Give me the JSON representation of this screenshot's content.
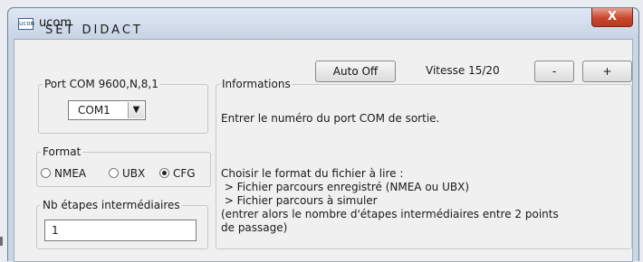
{
  "window": {
    "title": "ucom",
    "icon_label": "ucom-app-icon",
    "close_glyph": "X"
  },
  "heading": "SET DIDACT",
  "toolbar": {
    "auto_off_label": "Auto Off",
    "vitesse_label": "Vitesse 15/20",
    "minus_label": "-",
    "plus_label": "+"
  },
  "port_group": {
    "legend": "Port COM 9600,N,8,1",
    "selected": "COM1",
    "arrow": "▼"
  },
  "format_group": {
    "legend": "Format",
    "options": [
      {
        "label": "NMEA",
        "checked": false
      },
      {
        "label": "UBX",
        "checked": false
      },
      {
        "label": "CFG",
        "checked": true
      }
    ]
  },
  "steps_group": {
    "legend": "Nb étapes intermédiaires",
    "value": "1"
  },
  "info_group": {
    "legend": "Informations",
    "line1": "Entrer le numéro du port COM de sortie.",
    "block": [
      "Choisir le format du fichier à lire :",
      " > Fichier parcours enregistré (NMEA ou UBX)",
      " > Fichier parcours à simuler",
      "(entrer alors le nombre d'étapes intermédiaires entre 2 points",
      "de passage)"
    ]
  },
  "colors": {
    "close_button": "#c9462d",
    "client_bg": "#f0f0f0",
    "frame": "#c9d6e6"
  }
}
